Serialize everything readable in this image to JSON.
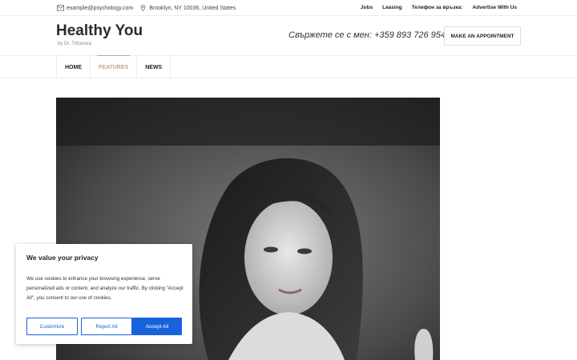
{
  "topbar": {
    "email": "example@psychology.com",
    "address": "Brooklyn, NY 10036, United States",
    "links": [
      "Jobs",
      "Leasing",
      "Телефон за връзка:",
      "Advertise With Us"
    ]
  },
  "header": {
    "brand": "Healthy You",
    "tagline": "by Dr. Trifonova",
    "phone": "Свържете се с мен: +359 893 726 954",
    "appointment_label": "MAKE AN APPOINTMENT"
  },
  "nav": {
    "items": [
      {
        "label": "HOME",
        "active": false
      },
      {
        "label": "FEATURES",
        "active": true
      },
      {
        "label": "NEWS",
        "active": false
      }
    ]
  },
  "cookie": {
    "title": "We value your privacy",
    "body": "We use cookies to enhance your browsing experience, serve personalized ads or content, and analyze our traffic. By clicking \"Accept All\", you consent to our use of cookies.",
    "customize_label": "Customize",
    "reject_label": "Reject All",
    "accept_label": "Accept All"
  },
  "colors": {
    "accent": "#c9a08f",
    "cookie_button": "#1863dc"
  },
  "icons": [
    "envelope-icon",
    "map-pin-icon"
  ]
}
